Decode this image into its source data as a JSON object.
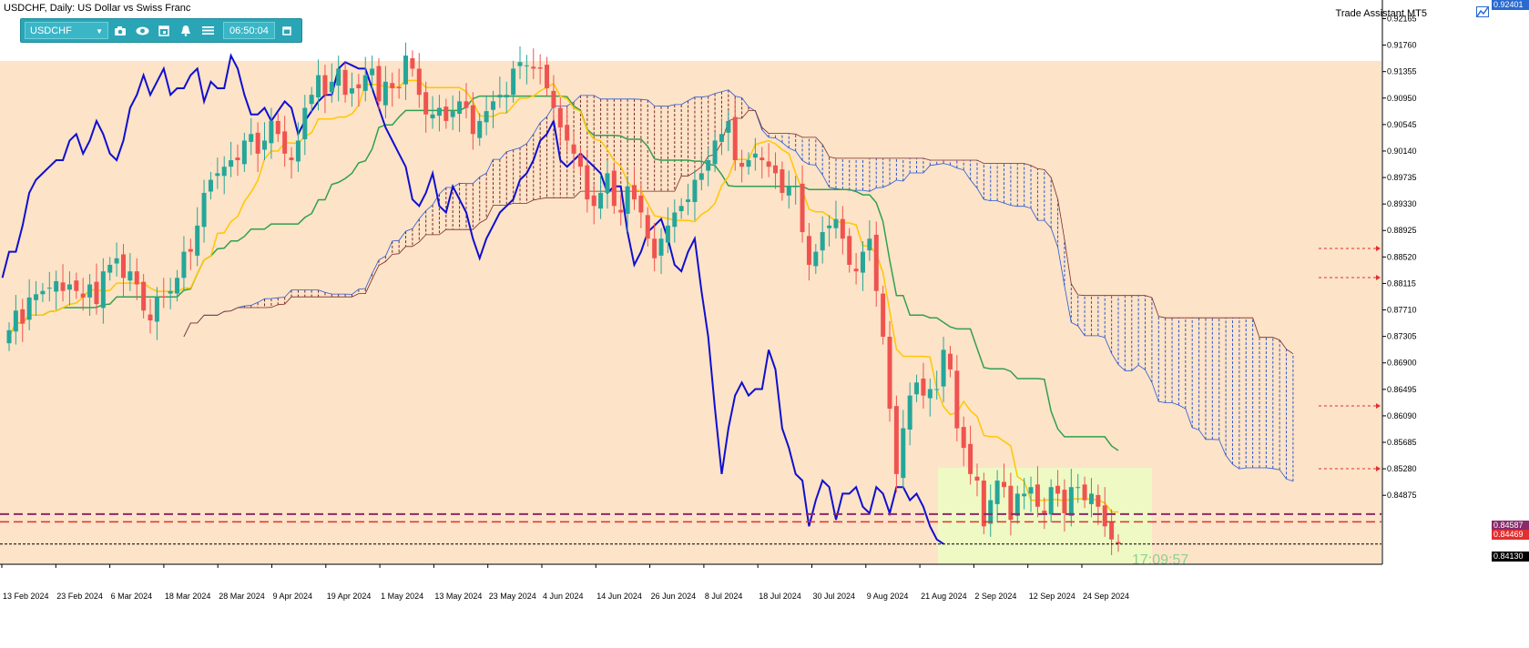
{
  "window": {
    "title": "USDCHF, Daily:  US Dollar vs Swiss Franc",
    "trade_assistant": "Trade Assistant MT5"
  },
  "toolbar": {
    "symbol": "USDCHF",
    "countdown": "06:50:04",
    "icons": [
      "camera-icon",
      "eye-icon",
      "calendar-icon",
      "alarm-icon",
      "menu-icon",
      "window-icon"
    ]
  },
  "countdown_overlay": "17:09:57",
  "price_labels": {
    "top": "0.92401",
    "line1": "0.84587",
    "line2": "0.84469",
    "current": "0.84130"
  },
  "colors": {
    "background": "#ffffff",
    "zone": "#fde3c7",
    "zone2": "#eef9c4",
    "bull": "#26a69a",
    "bear": "#ef5350",
    "tenkan": "#ffc700",
    "kijun": "#31a050",
    "chikou": "#0f0fd0",
    "cloud_bull": "#7a2a2a",
    "cloud_bear": "#2a5ad0",
    "dashed_purple": "#8a2a6a",
    "dashed_red": "#e03030"
  },
  "chart_data": {
    "type": "candlestick",
    "symbol": "USDCHF",
    "timeframe": "Daily",
    "y_axis": {
      "range": [
        0.8382,
        0.9245
      ],
      "ticks": [
        "0.92165",
        "0.91760",
        "0.91355",
        "0.90950",
        "0.90545",
        "0.90140",
        "0.89735",
        "0.89330",
        "0.88925",
        "0.88520",
        "0.88115",
        "0.87710",
        "0.87305",
        "0.86900",
        "0.86495",
        "0.86090",
        "0.85685",
        "0.85280",
        "0.84875"
      ]
    },
    "x_axis": {
      "ticks": [
        "13 Feb 2024",
        "23 Feb 2024",
        "6 Mar 2024",
        "18 Mar 2024",
        "28 Mar 2024",
        "9 Apr 2024",
        "19 Apr 2024",
        "1 May 2024",
        "13 May 2024",
        "23 May 2024",
        "4 Jun 2024",
        "14 Jun 2024",
        "26 Jun 2024",
        "8 Jul 2024",
        "18 Jul 2024",
        "30 Jul 2024",
        "9 Aug 2024",
        "21 Aug 2024",
        "2 Sep 2024",
        "12 Sep 2024",
        "24 Sep 2024"
      ]
    },
    "close": [
      0.874,
      0.877,
      0.875,
      0.879,
      0.8795,
      0.88,
      0.8805,
      0.8815,
      0.88,
      0.881,
      0.88,
      0.879,
      0.881,
      0.878,
      0.883,
      0.884,
      0.885,
      0.882,
      0.883,
      0.881,
      0.877,
      0.8755,
      0.879,
      0.879,
      0.88,
      0.882,
      0.886,
      0.886,
      0.89,
      0.895,
      0.897,
      0.898,
      0.899,
      0.9,
      0.9,
      0.903,
      0.904,
      0.901,
      0.903,
      0.906,
      0.904,
      0.901,
      0.9,
      0.903,
      0.908,
      0.91,
      0.913,
      0.91,
      0.912,
      0.914,
      0.91,
      0.911,
      0.911,
      0.913,
      0.914,
      0.909,
      0.912,
      0.911,
      0.911,
      0.916,
      0.914,
      0.91,
      0.907,
      0.907,
      0.908,
      0.906,
      0.9075,
      0.909,
      0.908,
      0.904,
      0.906,
      0.9075,
      0.909,
      0.91,
      0.91,
      0.914,
      0.915,
      0.9145,
      0.914,
      0.914,
      0.911,
      0.908,
      0.905,
      0.903,
      0.901,
      0.899,
      0.894,
      0.893,
      0.895,
      0.898,
      0.893,
      0.892,
      0.896,
      0.894,
      0.892,
      0.888,
      0.885,
      0.888,
      0.89,
      0.892,
      0.893,
      0.894,
      0.897,
      0.898,
      0.9,
      0.903,
      0.904,
      0.906,
      0.9,
      0.899,
      0.9,
      0.901,
      0.9,
      0.899,
      0.898,
      0.895,
      0.896,
      0.896,
      0.889,
      0.884,
      0.886,
      0.889,
      0.89,
      0.891,
      0.888,
      0.884,
      0.883,
      0.886,
      0.888,
      0.88,
      0.873,
      0.862,
      0.852,
      0.859,
      0.864,
      0.866,
      0.864,
      0.865,
      0.865,
      0.871,
      0.868,
      0.859,
      0.856,
      0.852,
      0.851,
      0.844,
      0.848,
      0.851,
      0.85,
      0.845,
      0.849,
      0.849,
      0.85,
      0.847,
      0.846,
      0.85,
      0.849,
      0.846,
      0.85,
      0.85,
      0.848,
      0.849,
      0.847,
      0.844,
      0.842,
      0.8413
    ]
  }
}
